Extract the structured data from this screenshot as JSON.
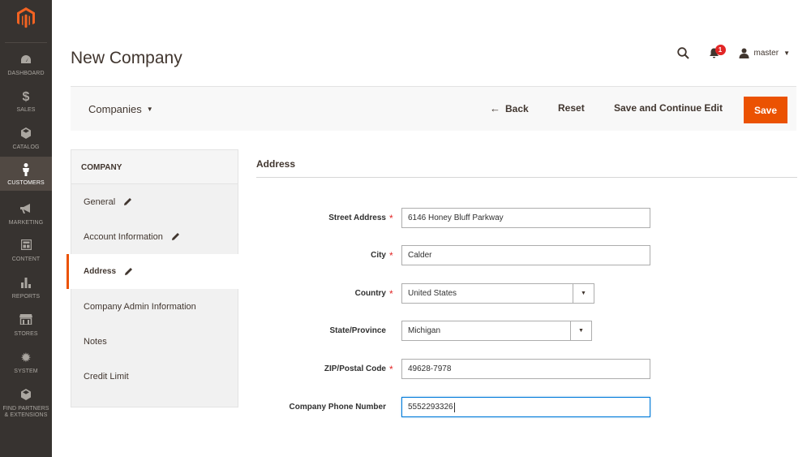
{
  "nav": {
    "items": [
      {
        "label": "DASHBOARD",
        "icon": "dashboard-icon"
      },
      {
        "label": "SALES",
        "icon": "dollar-icon"
      },
      {
        "label": "CATALOG",
        "icon": "cube-icon"
      },
      {
        "label": "CUSTOMERS",
        "icon": "person-icon"
      },
      {
        "label": "MARKETING",
        "icon": "megaphone-icon"
      },
      {
        "label": "CONTENT",
        "icon": "layout-icon"
      },
      {
        "label": "REPORTS",
        "icon": "bar-chart-icon"
      },
      {
        "label": "STORES",
        "icon": "store-icon"
      },
      {
        "label": "SYSTEM",
        "icon": "gear-icon"
      },
      {
        "label": "FIND PARTNERS",
        "label2": "& EXTENSIONS",
        "icon": "box-icon"
      }
    ],
    "active": "CUSTOMERS"
  },
  "header": {
    "title": "New Company",
    "notification_count": "1",
    "user": "master"
  },
  "actions": {
    "switcher": "Companies",
    "back": "Back",
    "reset": "Reset",
    "save_continue": "Save and Continue Edit",
    "save": "Save"
  },
  "tabs": {
    "heading": "COMPANY",
    "items": [
      {
        "label": "General",
        "edit": true
      },
      {
        "label": "Account Information",
        "edit": true
      },
      {
        "label": "Address",
        "edit": true,
        "active": true
      },
      {
        "label": "Company Admin Information",
        "edit": false
      },
      {
        "label": "Notes",
        "edit": false
      },
      {
        "label": "Credit Limit",
        "edit": false
      }
    ]
  },
  "form": {
    "section": "Address",
    "fields": [
      {
        "label": "Street Address",
        "required": true,
        "value": "6146 Honey Bluff Parkway",
        "type": "text"
      },
      {
        "label": "City",
        "required": true,
        "value": "Calder",
        "type": "text"
      },
      {
        "label": "Country",
        "required": true,
        "value": "United States",
        "type": "select"
      },
      {
        "label": "State/Province",
        "required": false,
        "value": "Michigan",
        "type": "select"
      },
      {
        "label": "ZIP/Postal Code",
        "required": true,
        "value": "49628-7978",
        "type": "text"
      },
      {
        "label": "Company Phone Number",
        "required": false,
        "value": "5552293326",
        "type": "text",
        "focused": true
      }
    ]
  },
  "colors": {
    "nav_bg": "#373330",
    "accent": "#eb5202",
    "required": "#e22626"
  }
}
